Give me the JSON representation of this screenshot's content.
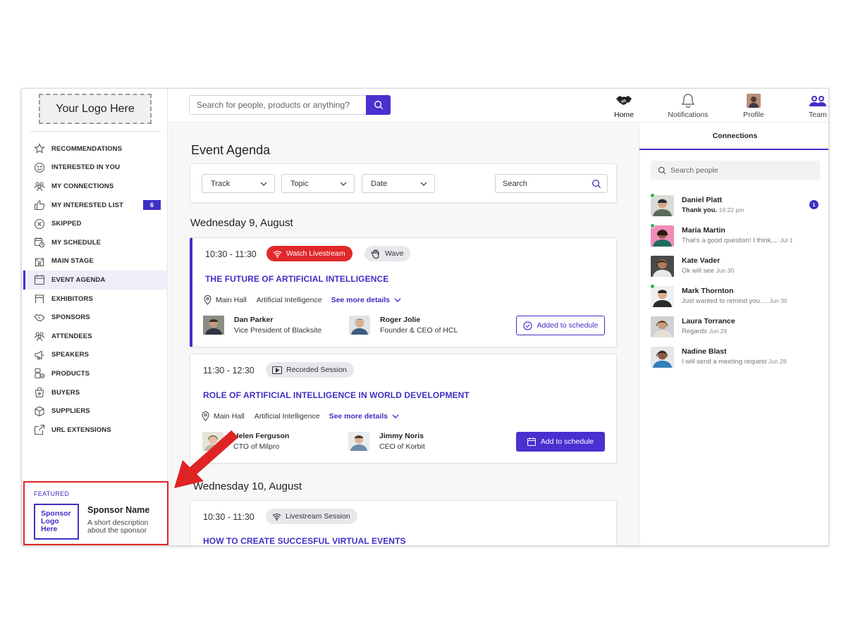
{
  "sidebar": {
    "logo": "Your Logo Here",
    "nav": [
      {
        "label": "RECOMMENDATIONS",
        "icon": "star-icon"
      },
      {
        "label": "INTERESTED IN YOU",
        "icon": "smiley-icon"
      },
      {
        "label": "MY CONNECTIONS",
        "icon": "people-icon"
      },
      {
        "label": "MY INTERESTED LIST",
        "icon": "thumbs-up-icon",
        "badge": "6"
      },
      {
        "label": "SKIPPED",
        "icon": "x-circle-icon"
      },
      {
        "label": "MY SCHEDULE",
        "icon": "calendar-clock-icon"
      },
      {
        "label": "MAIN STAGE",
        "icon": "stage-icon"
      },
      {
        "label": "EVENT AGENDA",
        "icon": "calendar-icon",
        "active": true
      },
      {
        "label": "EXHIBITORS",
        "icon": "booth-icon"
      },
      {
        "label": "SPONSORS",
        "icon": "handshake-icon"
      },
      {
        "label": "ATTENDEES",
        "icon": "group-icon"
      },
      {
        "label": "SPEAKERS",
        "icon": "megaphone-icon"
      },
      {
        "label": "PRODUCTS",
        "icon": "products-icon"
      },
      {
        "label": "BUYERS",
        "icon": "shopping-bag-icon"
      },
      {
        "label": "SUPPLIERS",
        "icon": "box-icon"
      },
      {
        "label": "URL EXTENSIONS",
        "icon": "external-link-icon"
      }
    ],
    "featured": {
      "label": "FEATURED",
      "logo_text": "Sponsor Logo Here",
      "name": "Sponsor Name",
      "description": "A short description about the sponsor"
    }
  },
  "topbar": {
    "search_placeholder": "Search for people, products or anything?",
    "nav": [
      {
        "label": "Home",
        "icon": "handshake-icon"
      },
      {
        "label": "Notifications",
        "icon": "bell-icon"
      },
      {
        "label": "Profile",
        "icon": "profile-avatar-icon"
      },
      {
        "label": "Team",
        "icon": "team-icon"
      }
    ]
  },
  "main": {
    "title": "Event Agenda",
    "filters": {
      "track": "Track",
      "topic": "Topic",
      "date": "Date",
      "search": "Search"
    },
    "days": [
      {
        "heading": "Wednesday 9, August",
        "sessions": [
          {
            "time": "10:30 - 11:30",
            "chip": "Watch Livestream",
            "extra_chip": "Wave",
            "title": "THE FUTURE OF ARTIFICIAL INTELLIGENCE",
            "room": "Main Hall",
            "track": "Artificial Intelligence",
            "more": "See more details",
            "speakers": [
              {
                "name": "Dan Parker",
                "role": "Vice President of Blacksite"
              },
              {
                "name": "Roger Jolie",
                "role": "Founder & CEO of HCL"
              }
            ],
            "button": "Added to schedule"
          },
          {
            "time": "11:30 - 12:30",
            "chip": "Recorded Session",
            "title": "ROLE OF ARTIFICIAL INTELLIGENCE IN WORLD DEVELOPMENT",
            "room": "Main Hall",
            "track": "Artificial Intelligence",
            "more": "See more details",
            "speakers": [
              {
                "name": "Helen Ferguson",
                "role": "CTO of Milpro"
              },
              {
                "name": "Jimmy Noris",
                "role": "CEO of Korbit"
              }
            ],
            "button": "Add to schedule"
          }
        ]
      },
      {
        "heading": "Wednesday 10, August",
        "sessions": [
          {
            "time": "10:30 - 11:30",
            "chip": "Livestream Session",
            "title": "HOW TO CREATE SUCCESFUL VIRTUAL EVENTS"
          }
        ]
      }
    ]
  },
  "right_panel": {
    "tab": "Connections",
    "search_placeholder": "Search people",
    "connections": [
      {
        "name": "Daniel Platt",
        "message": "Thank you.",
        "date": "16:22 pm",
        "online": true,
        "unread": "1"
      },
      {
        "name": "Maria Martin",
        "message": "That's a good question! I think,...",
        "date": "Jul 1",
        "online": true
      },
      {
        "name": "Kate Vader",
        "message": "Ok will see",
        "date": "Jun 30",
        "online": false
      },
      {
        "name": "Mark Thornton",
        "message": "Just wanted to remind you....",
        "date": "Jun 30",
        "online": true
      },
      {
        "name": "Laura Torrance",
        "message": "Regards",
        "date": "Jun 29",
        "online": false
      },
      {
        "name": "Nadine Blast",
        "message": "I will send a meeting request",
        "date": "Jun 28",
        "online": false
      }
    ]
  },
  "colors": {
    "accent": "#4b2fd0",
    "live": "#e0292a",
    "highlight_border": "#e02424",
    "online": "#29b34a"
  }
}
